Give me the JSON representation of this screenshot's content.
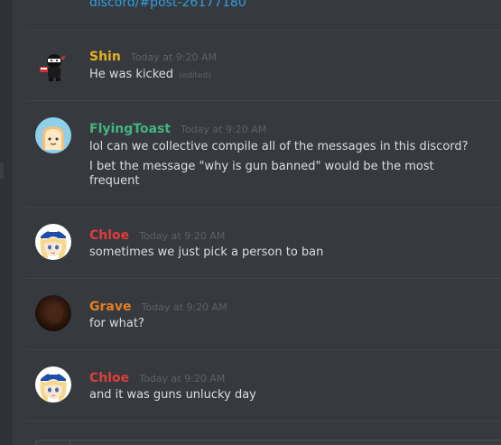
{
  "top_link": {
    "text": "discord/#post-26177180"
  },
  "messages": [
    {
      "username": "Shin",
      "username_color": "#e6b31e",
      "timestamp": "Today at 9:20 AM",
      "avatar": "ninja-avatar",
      "lines": [
        "He was kicked"
      ],
      "edited_label": "(edited)"
    },
    {
      "username": "FlyingToast",
      "username_color": "#43b581",
      "timestamp": "Today at 9:20 AM",
      "avatar": "toast-avatar",
      "lines": [
        "lol can we collective compile all of the messages in this discord?",
        "I bet the message \"why is gun banned\" would be the most",
        "frequent"
      ]
    },
    {
      "username": "Chloe",
      "username_color": "#e03c3c",
      "timestamp": "Today at 9:20 AM",
      "avatar": "anime-girl-avatar",
      "lines": [
        "sometimes we just pick a person to ban"
      ]
    },
    {
      "username": "Grave",
      "username_color": "#e67e22",
      "timestamp": "Today at 9:20 AM",
      "avatar": "dark-avatar",
      "lines": [
        "for what?"
      ]
    },
    {
      "username": "Chloe",
      "username_color": "#e03c3c",
      "timestamp": "Today at 9:20 AM",
      "avatar": "anime-girl-avatar",
      "lines": [
        "and it was guns unlucky day"
      ]
    }
  ],
  "colors": {
    "background": "#36393e",
    "link": "#2f9fe0",
    "text": "#dcddde",
    "timestamp": "#5d6169",
    "divider": "#40444b"
  }
}
